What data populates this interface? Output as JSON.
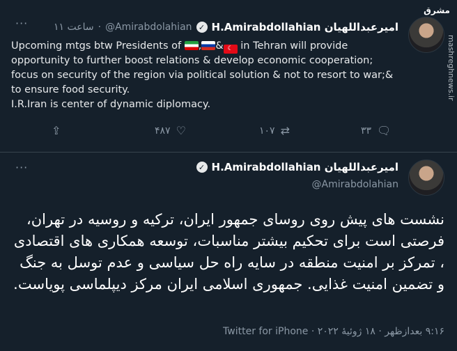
{
  "tweet1": {
    "name": "H.Amirabdollahian امیرعبداللهیان",
    "handle": "@Amirabdolahian",
    "time": "۱۱ ساعت",
    "text_pre": "Upcoming mtgs btw Presidents of",
    "text_mid": "in Tehran will provide",
    "lines": [
      "opportunity to further boost relations & develop economic cooperation;",
      "focus on security of the region via political solution & not to resort to war;&",
      "to ensure food security.",
      "I.R.Iran is center of dynamic diplomacy."
    ],
    "replies": "۳۳",
    "retweets": "۱۰۷",
    "likes": "۴۸۷"
  },
  "tweet2": {
    "name": "H.Amirabdollahian امیرعبداللهیان",
    "handle": "@Amirabdolahian",
    "text": "نشست های پیش روی روسای جمهور ایران، ترکیه و روسیه در تهران، فرصتی است برای تحکیم بیشتر مناسبات، توسعه همکاری های اقتصادی ، تمرکز بر امنیت منطقه در سایه راه حل سیاسی و عدم توسل به جنگ و تضمین امنیت غذایی. جمهوری اسلامی ایران مرکز دیپلماسی پویاست.",
    "meta": "۹:۱۶ بعدازظهر · ۱۸ ژوئیهٔ ۲۰۲۲ · Twitter for iPhone"
  },
  "watermark": {
    "logo": "مشرق",
    "site": "mashreghnews.ir"
  },
  "colors": {
    "bg": "#15202b",
    "muted": "#8b98a5",
    "divider": "#38444d"
  },
  "icons": {
    "more": "more-icon",
    "verified": "verified-icon",
    "reply": "reply-icon",
    "retweet": "retweet-icon",
    "like": "like-icon"
  }
}
